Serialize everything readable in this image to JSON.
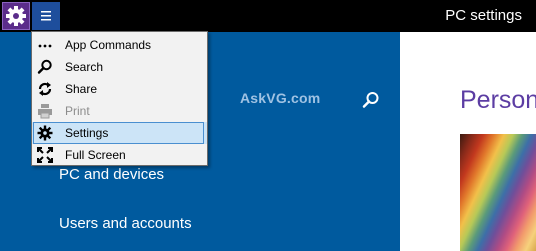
{
  "window": {
    "title": "PC settings"
  },
  "titlebar": {
    "app_icon": "gear-icon",
    "menu_button_icon": "hamburger-icon"
  },
  "context_menu": {
    "items": [
      {
        "label": "App Commands",
        "icon": "ellipsis-icon",
        "enabled": true,
        "selected": false
      },
      {
        "label": "Search",
        "icon": "search-icon",
        "enabled": true,
        "selected": false
      },
      {
        "label": "Share",
        "icon": "share-icon",
        "enabled": true,
        "selected": false
      },
      {
        "label": "Print",
        "icon": "print-icon",
        "enabled": false,
        "selected": false
      },
      {
        "label": "Settings",
        "icon": "gear-icon",
        "enabled": true,
        "selected": true
      },
      {
        "label": "Full Screen",
        "icon": "fullscreen-icon",
        "enabled": true,
        "selected": false
      }
    ]
  },
  "left_pane": {
    "watermark": "AskVG.com",
    "search_icon": "search-icon",
    "items": [
      {
        "label": "PC and devices"
      },
      {
        "label": "Users and accounts"
      }
    ]
  },
  "right_pane": {
    "heading": "Person"
  },
  "colors": {
    "titlebar": "#000000",
    "left_pane": "#005a9e",
    "accent_purple": "#5b2d8a",
    "heading": "#5c3da3",
    "menu_selected": "#cce4f7"
  }
}
